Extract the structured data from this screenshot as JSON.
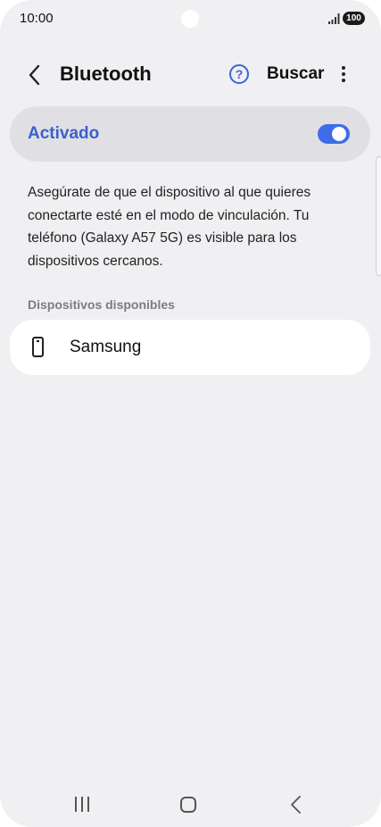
{
  "status_bar": {
    "time": "10:00",
    "battery": "100",
    "icons": [
      "signal-icon",
      "battery-icon"
    ]
  },
  "header": {
    "back_icon": "chevron-left-icon",
    "title": "Bluetooth",
    "help_icon": "question-circle-icon",
    "help_glyph": "?",
    "search_label": "Buscar",
    "more_icon": "more-vertical-icon"
  },
  "bluetooth": {
    "toggle_label": "Activado",
    "enabled": true,
    "accent_color": "#3e6de8"
  },
  "description": "Asegúrate de que el dispositivo al que quieres conectarte esté en el modo de vinculación. Tu teléfono (Galaxy A57 5G) es visible para los dispositivos cercanos.",
  "available_devices": {
    "header": "Dispositivos disponibles",
    "items": [
      {
        "name": "Samsung",
        "icon": "smartphone-icon"
      }
    ]
  },
  "nav_bar": {
    "icons": [
      "recents-icon",
      "home-icon",
      "back-icon"
    ]
  }
}
